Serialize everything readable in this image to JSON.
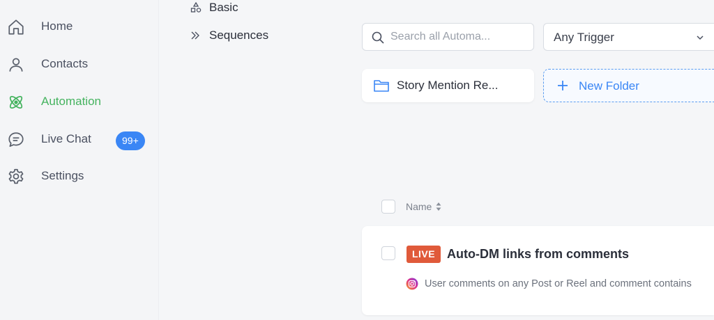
{
  "sidebar": {
    "items": [
      {
        "label": "Home",
        "icon": "home-icon"
      },
      {
        "label": "Contacts",
        "icon": "person-icon"
      },
      {
        "label": "Automation",
        "icon": "atom-icon",
        "active": true
      },
      {
        "label": "Live Chat",
        "icon": "chat-bubble-icon",
        "badge": "99+"
      },
      {
        "label": "Settings",
        "icon": "gear-icon"
      }
    ]
  },
  "subnav": {
    "basic": {
      "label": "Basic",
      "icon": "shapes-icon"
    },
    "sequences": {
      "label": "Sequences",
      "icon": "double-chevron-icon"
    }
  },
  "toolbar": {
    "search_placeholder": "Search all Automa...",
    "trigger_select": "Any Trigger"
  },
  "folders": {
    "folder_name": "Story Mention Re...",
    "new_folder_label": "New Folder"
  },
  "table": {
    "name_header": "Name",
    "rows": [
      {
        "status": "LIVE",
        "title": "Auto-DM links from comments",
        "description": "User comments on any Post or Reel and comment contains"
      }
    ]
  },
  "colors": {
    "accent_green": "#45b35f",
    "accent_blue": "#3a86f5",
    "live_red": "#e05a3a"
  }
}
